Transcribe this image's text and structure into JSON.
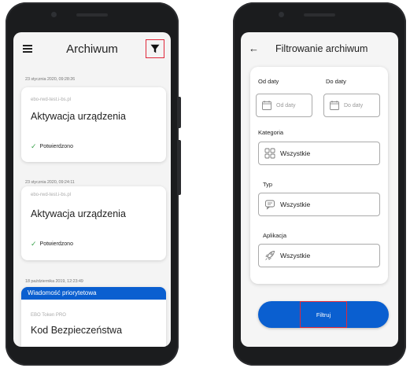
{
  "archive_screen": {
    "title": "Archiwum",
    "icons": {
      "menu": "hamburger-menu-icon",
      "filter": "filter-funnel-icon"
    },
    "items": [
      {
        "timestamp": "23 stycznia 2020, 09:28:26",
        "source": "ebo-rwd-test.i-bs.pl",
        "title": "Aktywacja urządzenia",
        "status": "Potwierdzono"
      },
      {
        "timestamp": "23 stycznia 2020, 09:24:11",
        "source": "ebo-rwd-test.i-bs.pl",
        "title": "Aktywacja urządzenia",
        "status": "Potwierdzono"
      },
      {
        "timestamp": "18 października 2019, 12:23:49",
        "banner": "Wiadomość priorytetowa",
        "source": "EBO Token PRO",
        "title": "Kod Bezpieczeństwa"
      }
    ]
  },
  "filter_screen": {
    "title": "Filtrowanie archiwum",
    "from_label": "Od daty",
    "from_placeholder": "Od daty",
    "to_label": "Do daty",
    "to_placeholder": "Do daty",
    "category_label": "Kategoria",
    "category_value": "Wszystkie",
    "type_label": "Typ",
    "type_value": "Wszystkie",
    "app_label": "Aplikacja",
    "app_value": "Wszystkie",
    "submit_label": "Filtruj"
  },
  "colors": {
    "accent_blue": "#0a5fd0",
    "highlight_red": "#e0283a",
    "confirm_green": "#3aa14c"
  }
}
